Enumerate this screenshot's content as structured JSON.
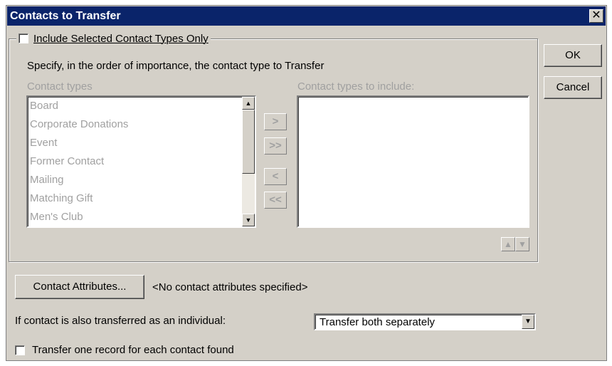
{
  "window": {
    "title": "Contacts to Transfer",
    "close_glyph": "✕"
  },
  "group": {
    "checkbox_label": "Include Selected Contact Types Only",
    "checked": false
  },
  "instructions": "Specify, in the order of importance, the contact type to Transfer",
  "available": {
    "label": "Contact types",
    "items": [
      "Board",
      "Corporate Donations",
      "Event",
      "Former Contact",
      "Mailing",
      "Matching Gift",
      "Men's Club"
    ]
  },
  "selected": {
    "label": "Contact types to include:",
    "items": []
  },
  "move_buttons": {
    "add": ">",
    "add_all": ">>",
    "remove": "<",
    "remove_all": "<<"
  },
  "buttons": {
    "ok": "OK",
    "cancel": "Cancel",
    "contact_attributes": "Contact Attributes..."
  },
  "attributes_status": "<No contact attributes specified>",
  "individual": {
    "label": "If contact is also transferred as an individual:",
    "value": "Transfer both separately"
  },
  "one_record": {
    "label": "Transfer one record for each contact found",
    "checked": false
  }
}
